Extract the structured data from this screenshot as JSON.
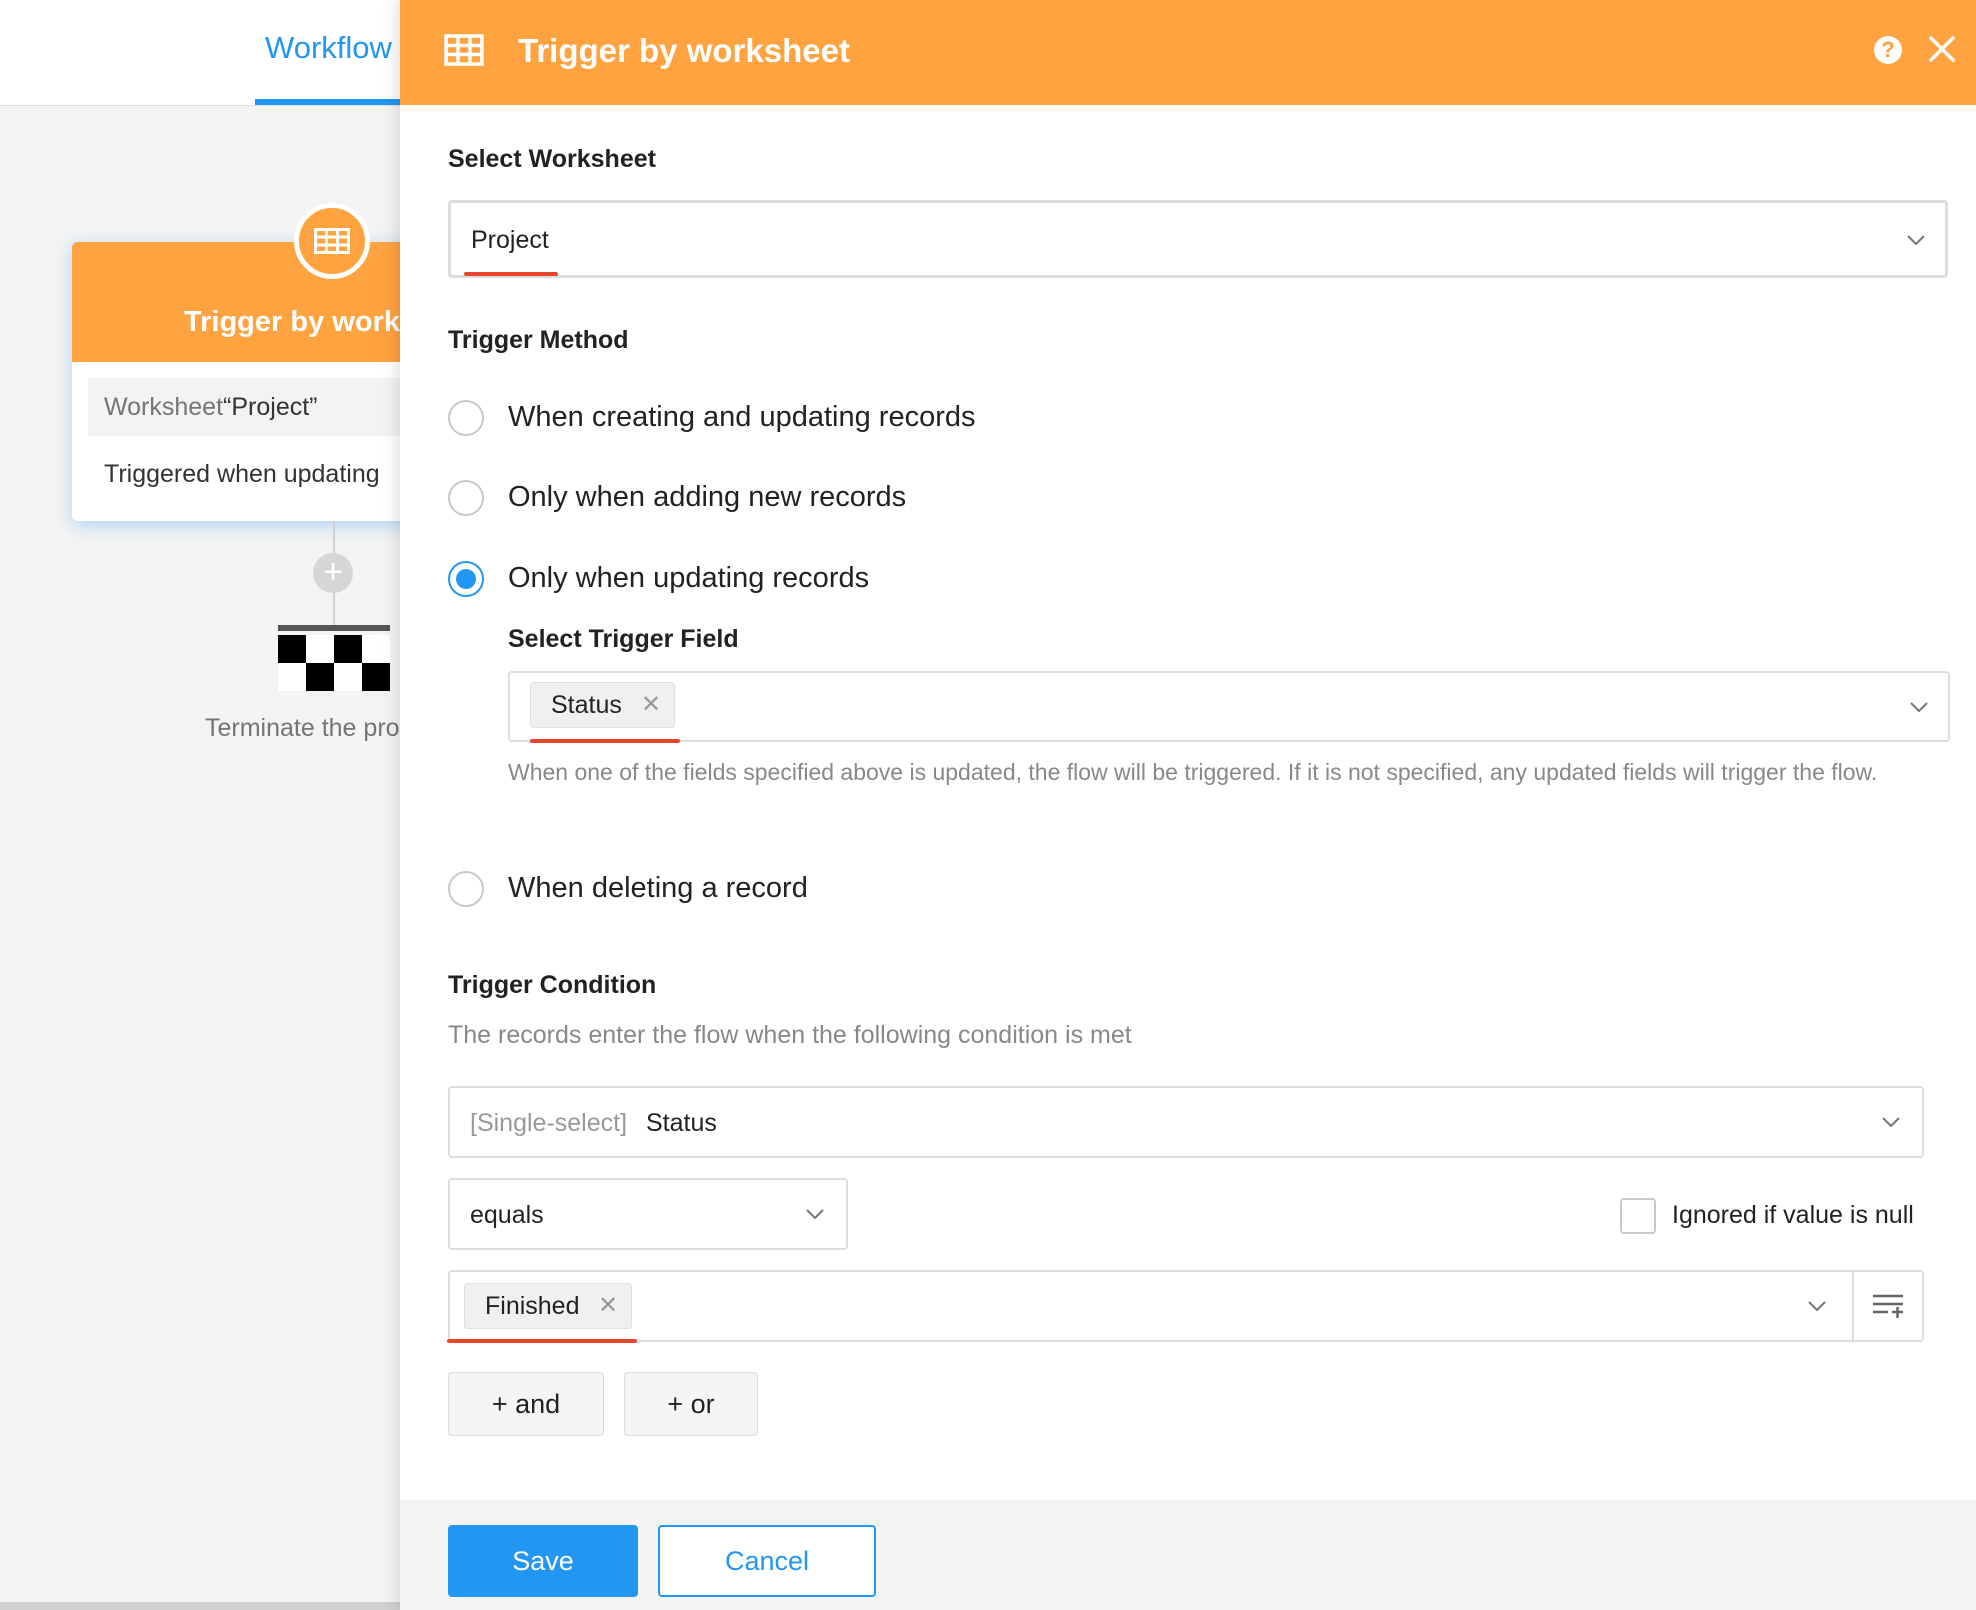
{
  "background": {
    "tab_label": "Workflow",
    "node": {
      "title": "Trigger by worksheet",
      "worksheet_prefix": "Worksheet",
      "worksheet_name": "“Project”",
      "trigger_text": "Triggered when updating"
    },
    "terminate_text": "Terminate the process"
  },
  "panel": {
    "title": "Trigger by worksheet",
    "select_worksheet_label": "Select Worksheet",
    "worksheet_value": "Project",
    "trigger_method_label": "Trigger Method",
    "methods": [
      {
        "label": "When creating and updating records",
        "checked": false
      },
      {
        "label": "Only when adding new records",
        "checked": false
      },
      {
        "label": "Only when updating records",
        "checked": true
      },
      {
        "label": "When deleting a record",
        "checked": false
      }
    ],
    "trigger_field_label": "Select Trigger Field",
    "trigger_field_tag": "Status",
    "trigger_field_hint": "When one of the fields specified above is updated, the flow will be triggered. If it is not specified, any updated fields will trigger the flow.",
    "trigger_condition_label": "Trigger Condition",
    "trigger_condition_hint": "The records enter the flow when the following condition is met",
    "condition_field_type": "[Single-select]",
    "condition_field_name": "Status",
    "operator_value": "equals",
    "ignore_null_label": "Ignored if value is null",
    "condition_value_tag": "Finished",
    "and_button": "+ and",
    "or_button": "+ or",
    "save_button": "Save",
    "cancel_button": "Cancel"
  },
  "colors": {
    "header_orange": "#ffa340",
    "primary_blue": "#2196f3",
    "highlight_red": "#e8452c"
  }
}
